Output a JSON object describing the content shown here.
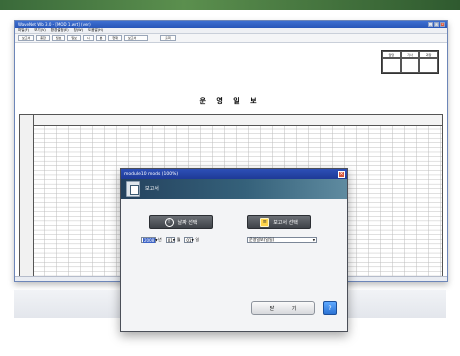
{
  "app": {
    "title": "WaveNet Wb 3.0 - [MOD 1.wrt] (ver)",
    "menu": [
      "파일(F)",
      "보기(V)",
      "환경설정(E)",
      "창(W)",
      "도움말(H)"
    ],
    "toolbar": [
      "보고서",
      "종합",
      "월보",
      "일보",
      "시",
      "분",
      "현재",
      "보고서"
    ],
    "print_label": "출력"
  },
  "report": {
    "title": "운 영 일 보",
    "approval_headers": [
      "담당",
      "기사",
      "과장"
    ]
  },
  "dialog": {
    "title": "module10 mods (100%)",
    "header_title": "보고서",
    "date_option_label": "날짜 선택",
    "report_option_label": "보고서 선택",
    "year": "2008",
    "year_unit": "년",
    "month": "01",
    "month_unit": "월",
    "day": "01",
    "day_unit": "일",
    "report_type": "운영일보(일일)",
    "close_label": "닫 기",
    "help_label": "?"
  },
  "colors": {
    "header_band": "#35617a",
    "title_bar": "#2d4fb7",
    "option_button": "#4a4e54"
  }
}
